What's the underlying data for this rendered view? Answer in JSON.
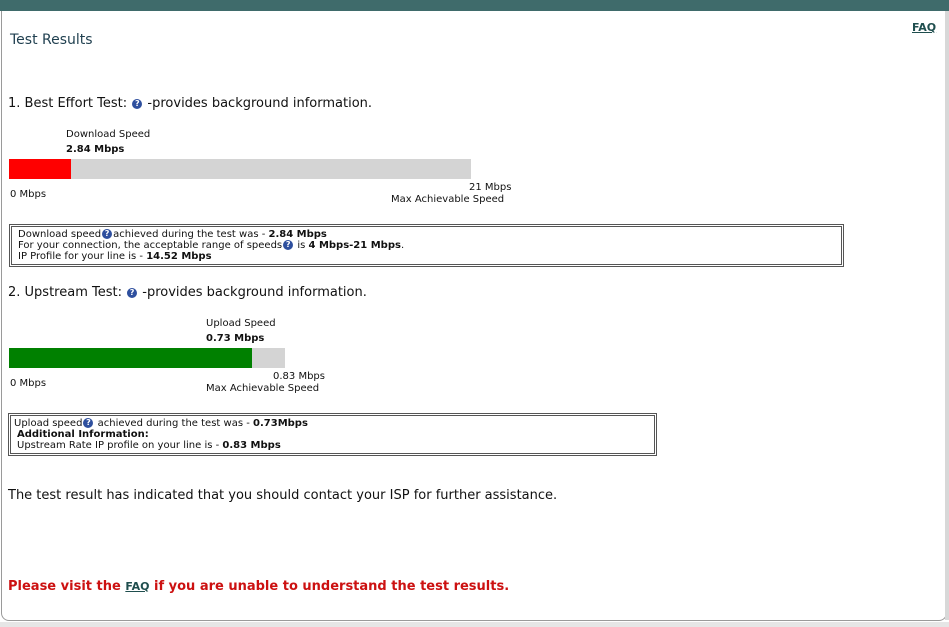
{
  "header": {
    "faq_label": "FAQ",
    "title": "Test Results"
  },
  "best_effort": {
    "heading": "1. Best Effort Test:",
    "help_icon": "question-icon",
    "desc": "-provides background information.",
    "label": "Download  Speed",
    "value": "2.84 Mbps",
    "min_label": "0 Mbps",
    "max_value_label": "21 Mbps",
    "max_label": "Max Achievable Speed",
    "fill_fraction": 0.135,
    "fill_color": "#ff0000",
    "info": {
      "line1_pre": "Download speed",
      "line1_mid": "achieved during the test was - ",
      "line1_val": "2.84 Mbps",
      "line2_pre": "For your connection, the acceptable range of speeds",
      "line2_mid": " is ",
      "line2_val": "4 Mbps-21 Mbps",
      "line2_end": ".",
      "line3_pre": "IP Profile for your line is - ",
      "line3_val": "14.52 Mbps"
    }
  },
  "upstream": {
    "heading": "2. Upstream Test:",
    "help_icon": "question-icon",
    "desc": "-provides background information.",
    "label": "Upload Speed",
    "value": "0.73 Mbps",
    "min_label": "0 Mbps",
    "max_value_label": "0.83 Mbps",
    "max_label": "Max Achievable Speed",
    "fill_fraction": 0.88,
    "fill_color": "#008000",
    "info": {
      "line1_pre": "Upload speed",
      "line1_mid": " achieved during the test was - ",
      "line1_val": "0.73Mbps",
      "line2": "Additional Information:",
      "line3_pre": "Upstream Rate IP profile on your line is - ",
      "line3_val": "0.83 Mbps"
    }
  },
  "footer": {
    "contact": "The test result has indicated that you should contact your ISP for further assistance.",
    "visit_pre": "Please visit the ",
    "visit_link": "FAQ",
    "visit_post": " if you are unable to understand the test results."
  },
  "colors": {
    "topbar": "#3f6b6b",
    "alert": "#cc1111"
  }
}
